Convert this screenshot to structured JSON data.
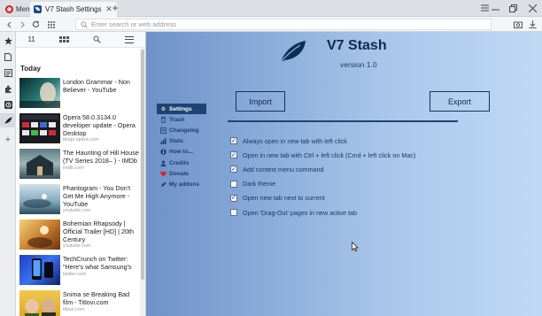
{
  "browser": {
    "menu_label": "Menu",
    "tab_title": "V7 Stash Settings",
    "tab_close": "✕",
    "new_tab": "+",
    "url_placeholder": "Enter search or web address"
  },
  "sidebar": {
    "icons": [
      "star-icon",
      "document-icon",
      "news-icon",
      "extensions-icon",
      "history-icon",
      "v7stash-icon",
      "add-icon"
    ]
  },
  "panel": {
    "count": "11",
    "section": "Today",
    "items": [
      {
        "title": "London Grammar - Non Believer - YouTube",
        "domain": ""
      },
      {
        "title": "Opera 58.0.3134.0 developer update - Opera Desktop",
        "domain": "blogs.opera.com"
      },
      {
        "title": "The Haunting of Hill House (TV Series 2018– ) - IMDb",
        "domain": "imdb.com"
      },
      {
        "title": "Phantogram - You Don't Get Me High Anymore - YouTube",
        "domain": "youtube.com"
      },
      {
        "title": "Bohemian Rhapsody | Official Trailer [HD] | 20th Century",
        "domain": "youtube.com"
      },
      {
        "title": "TechCrunch on Twitter: \"Here's what Samsung's",
        "domain": "twitter.com"
      },
      {
        "title": "Snima se Breaking Bad film - Titlovi.com",
        "domain": "titlovi.com"
      }
    ]
  },
  "app": {
    "title": "V7 Stash",
    "version": "version 1.0",
    "nav": [
      {
        "label": "Settings",
        "icon": "gear-icon",
        "active": true
      },
      {
        "label": "Trash",
        "icon": "trash-icon",
        "active": false
      },
      {
        "label": "Changelog",
        "icon": "changelog-icon",
        "active": false
      },
      {
        "label": "Stats",
        "icon": "stats-icon",
        "active": false
      },
      {
        "label": "How to...",
        "icon": "howto-icon",
        "active": false
      },
      {
        "label": "Credits",
        "icon": "credits-icon",
        "active": false
      },
      {
        "label": "Donate",
        "icon": "heart-icon",
        "active": false
      },
      {
        "label": "My addons",
        "icon": "addons-icon",
        "active": false
      }
    ],
    "import_label": "Import",
    "export_label": "Export",
    "options": [
      {
        "label": "Always open in new tab with left click",
        "checked": true
      },
      {
        "label": "Open in new tab with Ctrl + left click (Cmd + left click on Mac)",
        "checked": true
      },
      {
        "label": "Add context menu command",
        "checked": true
      },
      {
        "label": "Dark theme",
        "checked": false
      },
      {
        "label": "Open new tab next to current",
        "checked": true
      },
      {
        "label": "Open 'Drag-Out' pages in new active tab",
        "checked": false
      }
    ]
  },
  "colors": {
    "accent": "#1d4472",
    "opera_red": "#e0161b"
  }
}
